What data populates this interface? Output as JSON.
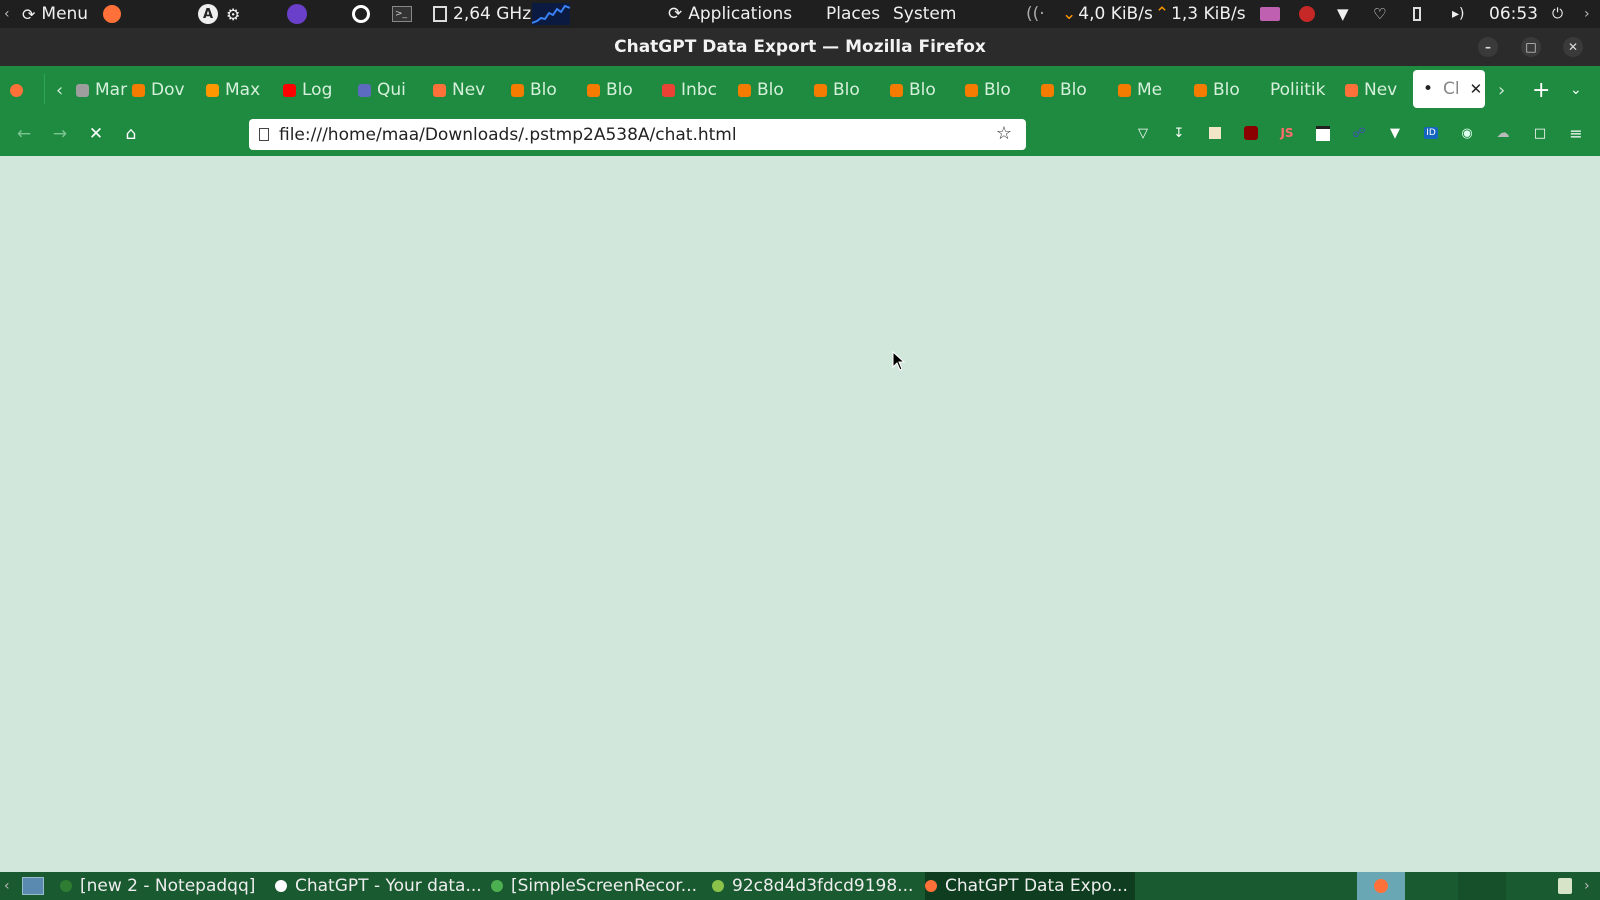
{
  "top_panel": {
    "menu_label": "Menu",
    "cpu_freq": "2,64 GHz",
    "applications": "Applications",
    "places": "Places",
    "system": "System",
    "net_down": "4,0 KiB/s",
    "net_up": "1,3 KiB/s",
    "clock": "06:53"
  },
  "window": {
    "title": "ChatGPT Data Export — Mozilla Firefox"
  },
  "tabs": [
    {
      "label": "Mar",
      "color": "#9e9e9e"
    },
    {
      "label": "Dov",
      "color": "#f57c00"
    },
    {
      "label": "Max",
      "color": "#ff9800"
    },
    {
      "label": "Log",
      "color": "#ff0000"
    },
    {
      "label": "Qui",
      "color": "#5c6bc0"
    },
    {
      "label": "Nev",
      "color": "#ff7139"
    },
    {
      "label": "Blo",
      "color": "#f57c00"
    },
    {
      "label": "Blo",
      "color": "#f57c00"
    },
    {
      "label": "Inbc",
      "color": "#ea4335"
    },
    {
      "label": "Blo",
      "color": "#f57c00"
    },
    {
      "label": "Blo",
      "color": "#f57c00"
    },
    {
      "label": "Blo",
      "color": "#f57c00"
    },
    {
      "label": "Blo",
      "color": "#f57c00"
    },
    {
      "label": "Blo",
      "color": "#f57c00"
    },
    {
      "label": "Me",
      "color": "#f57c00"
    },
    {
      "label": "Blo",
      "color": "#f57c00"
    },
    {
      "label": "Poliitik",
      "color": ""
    },
    {
      "label": "Nev",
      "color": "#ff7139"
    }
  ],
  "active_tab": {
    "label": "Cl"
  },
  "navbar": {
    "url": "file:///home/maa/Downloads/.pstmp2A538A/chat.html"
  },
  "taskbar": {
    "items": [
      {
        "label": "[new 2 - Notepadqq]",
        "icon": "notepadqq-icon",
        "color": "#2e7d32"
      },
      {
        "label": "ChatGPT - Your data...",
        "icon": "opera-icon",
        "color": "#ffffff"
      },
      {
        "label": "[SimpleScreenRecor...",
        "icon": "recorder-icon",
        "color": "#4caf50"
      },
      {
        "label": "92c8d4d3fdcd9198...",
        "icon": "image-viewer-icon",
        "color": "#8bc34a"
      },
      {
        "label": "ChatGPT Data Expo...",
        "icon": "firefox-icon",
        "color": "#ff7139"
      }
    ]
  },
  "colors": {
    "accent_green": "#1e8b40",
    "content_bg": "#d2e7dc",
    "taskbar_bg": "#1a5a30"
  }
}
